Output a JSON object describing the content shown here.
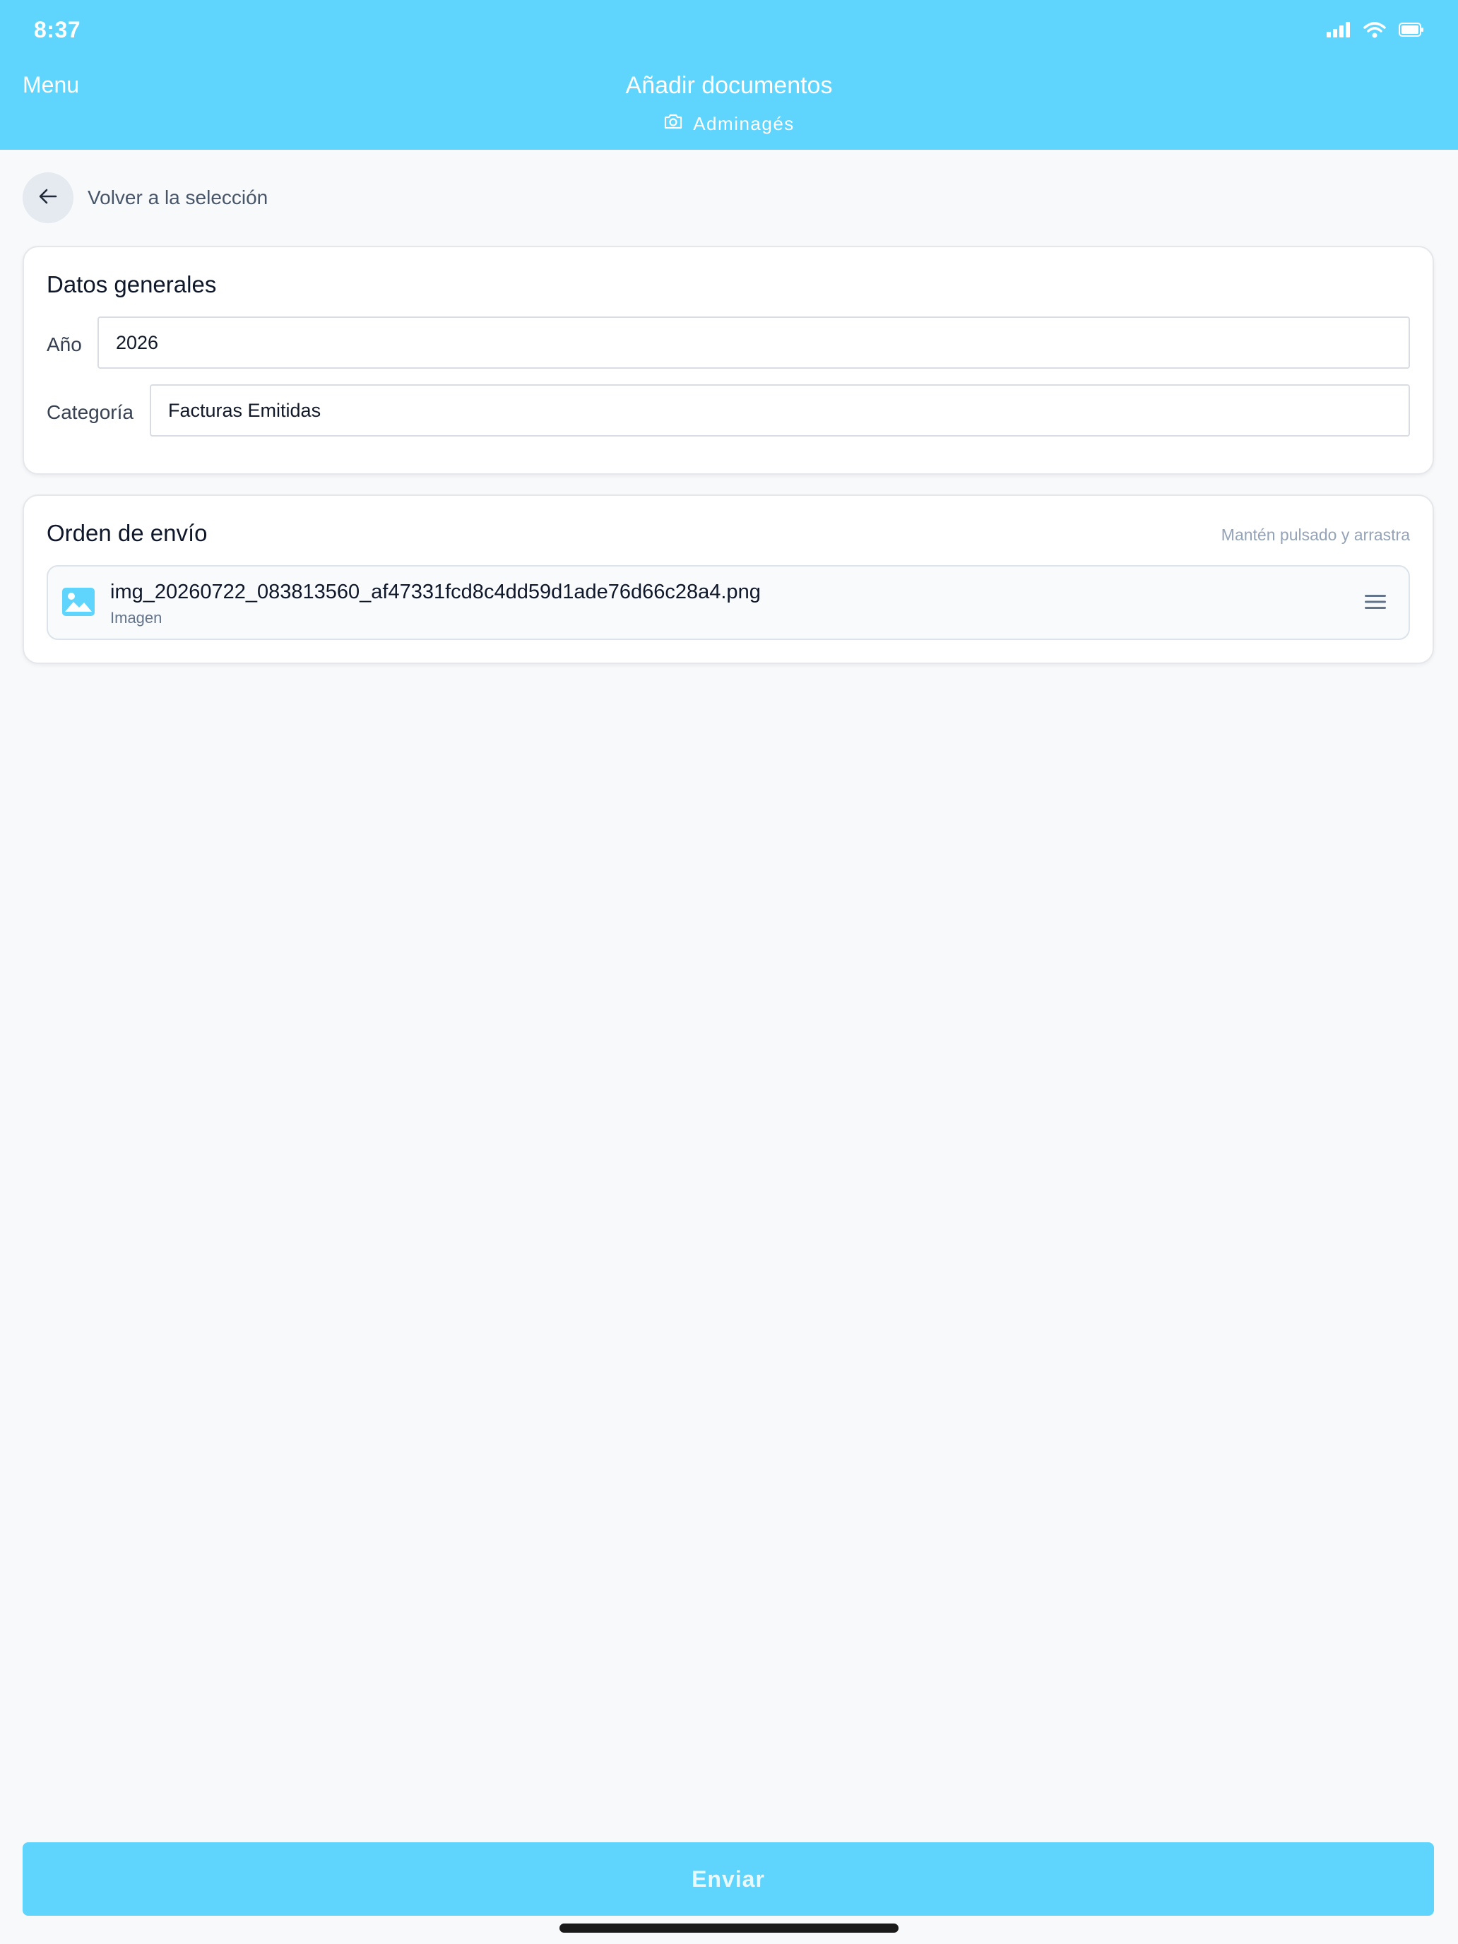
{
  "status_bar": {
    "time": "8:37"
  },
  "nav": {
    "menu_label": "Menu",
    "title": "Añadir documentos",
    "subtitle": "Adminagés"
  },
  "back": {
    "label": "Volver a la selección"
  },
  "general": {
    "title": "Datos generales",
    "year_label": "Año",
    "year_value": "2026",
    "category_label": "Categoría",
    "category_value": "Facturas Emitidas"
  },
  "order": {
    "title": "Orden de envío",
    "hint": "Mantén pulsado y arrastra",
    "items": [
      {
        "name": "img_20260722_083813560_af47331fcd8c4dd59d1ade76d66c28a4.png",
        "type": "Imagen"
      }
    ]
  },
  "submit": {
    "label": "Enviar"
  },
  "colors": {
    "accent": "#5fd4fd",
    "background": "#f8f9fb"
  }
}
